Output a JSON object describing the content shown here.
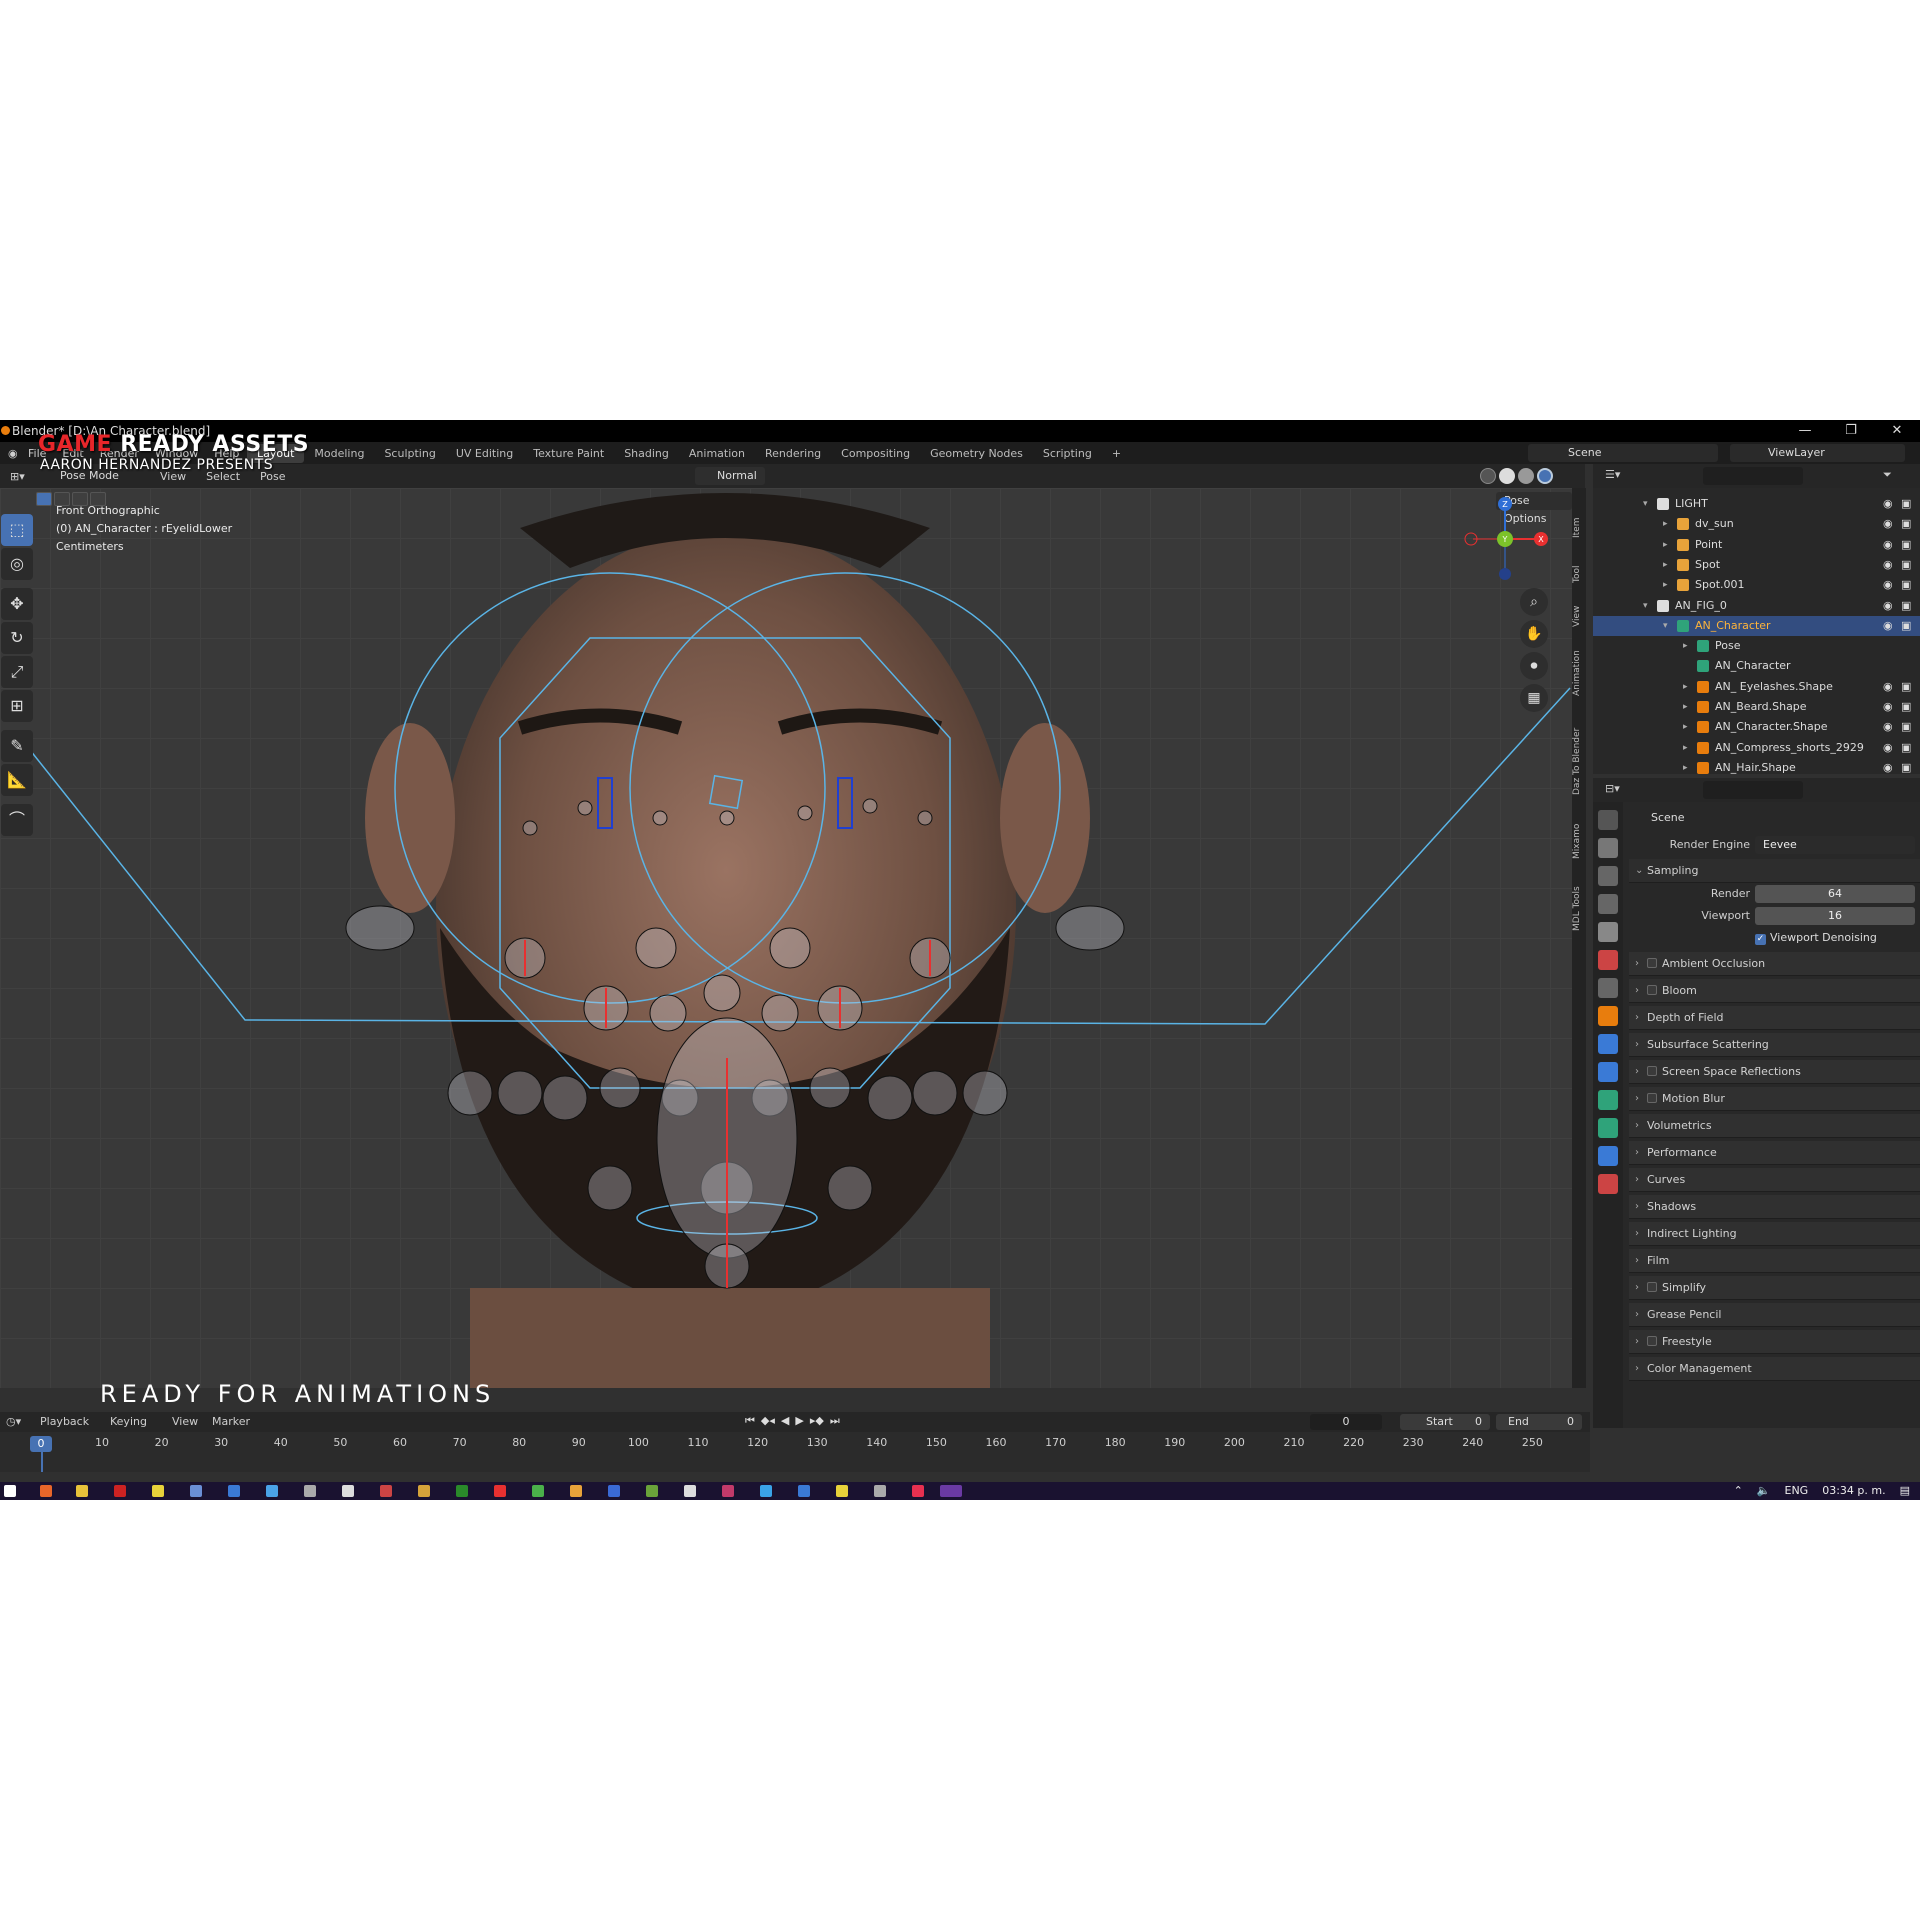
{
  "window": {
    "title": "Blender* [D:\\An Character.blend]",
    "controls": [
      "—",
      "❐",
      "✕"
    ]
  },
  "promo": {
    "title_red": "GAME",
    "title_white": "READY ASSETS",
    "subtitle": "AARON HERNANDEZ PRESENTS",
    "bottom": "READY FOR ANIMATIONS"
  },
  "menubar": {
    "items": [
      "File",
      "Edit",
      "Render",
      "Window",
      "Help"
    ],
    "workspaces": [
      "Layout",
      "Modeling",
      "Sculpting",
      "UV Editing",
      "Texture Paint",
      "Shading",
      "Animation",
      "Rendering",
      "Compositing",
      "Geometry Nodes",
      "Scripting",
      "+"
    ],
    "scene": "Scene",
    "view_layer": "ViewLayer"
  },
  "viewport_header": {
    "mode": "Pose Mode",
    "menus": [
      "View",
      "Select",
      "Pose"
    ],
    "orientation": "Normal",
    "pose_options": "Pose Options"
  },
  "viewport": {
    "view_name": "Front Orthographic",
    "active_object": "(0) AN_Character : rEyelidLower",
    "units": "Centimeters"
  },
  "toolbar": {
    "tools": [
      {
        "name": "select-box-tool",
        "glyph": "⬚",
        "active": true
      },
      {
        "name": "cursor-tool",
        "glyph": "◎",
        "active": false
      },
      {
        "name": "move-tool",
        "glyph": "✥",
        "active": false
      },
      {
        "name": "rotate-tool",
        "glyph": "↻",
        "active": false
      },
      {
        "name": "scale-tool",
        "glyph": "⤢",
        "active": false
      },
      {
        "name": "transform-tool",
        "glyph": "⊞",
        "active": false
      },
      {
        "name": "annotate-tool",
        "glyph": "✎",
        "active": false
      },
      {
        "name": "measure-tool",
        "glyph": "📐",
        "active": false
      },
      {
        "name": "bone-roll-tool",
        "glyph": "⌒",
        "active": false
      }
    ]
  },
  "gizmo": {
    "z": "Z",
    "y": "Y",
    "x": "X"
  },
  "npanel_tabs": [
    "Item",
    "Tool",
    "View",
    "Animation",
    "Daz To Blender",
    "Mixamo",
    "MDL Tools"
  ],
  "outliner": {
    "rows": [
      {
        "label": "LIGHT",
        "indent": 0,
        "type": "collection",
        "arrow": "▾",
        "selected": false
      },
      {
        "label": "dv_sun",
        "indent": 1,
        "type": "light",
        "arrow": "▸",
        "selected": false
      },
      {
        "label": "Point",
        "indent": 1,
        "type": "light",
        "arrow": "▸",
        "selected": false
      },
      {
        "label": "Spot",
        "indent": 1,
        "type": "light",
        "arrow": "▸",
        "selected": false
      },
      {
        "label": "Spot.001",
        "indent": 1,
        "type": "light",
        "arrow": "▸",
        "selected": false
      },
      {
        "label": "AN_FIG_0",
        "indent": 0,
        "type": "collection",
        "arrow": "▾",
        "selected": false
      },
      {
        "label": "AN_Character",
        "indent": 1,
        "type": "armature",
        "arrow": "▾",
        "selected": true
      },
      {
        "label": "Pose",
        "indent": 2,
        "type": "pose",
        "arrow": "▸",
        "selected": false
      },
      {
        "label": "AN_Character",
        "indent": 2,
        "type": "armature-data",
        "arrow": "",
        "selected": false
      },
      {
        "label": "AN_ Eyelashes.Shape",
        "indent": 2,
        "type": "mesh",
        "arrow": "▸",
        "selected": false
      },
      {
        "label": "AN_Beard.Shape",
        "indent": 2,
        "type": "mesh",
        "arrow": "▸",
        "selected": false
      },
      {
        "label": "AN_Character.Shape",
        "indent": 2,
        "type": "mesh",
        "arrow": "▸",
        "selected": false
      },
      {
        "label": "AN_Compress_shorts_2929",
        "indent": 2,
        "type": "mesh",
        "arrow": "▸",
        "selected": false
      },
      {
        "label": "AN_Hair.Shape",
        "indent": 2,
        "type": "mesh",
        "arrow": "▸",
        "selected": false
      }
    ]
  },
  "properties": {
    "scene": "Scene",
    "render_engine_label": "Render Engine",
    "render_engine_value": "Eevee",
    "sampling_label": "Sampling",
    "render_label": "Render",
    "render_value": "64",
    "viewport_label": "Viewport",
    "viewport_value": "16",
    "denoising_label": "Viewport Denoising",
    "panels": [
      {
        "label": "Ambient Occlusion",
        "checkbox": true
      },
      {
        "label": "Bloom",
        "checkbox": true
      },
      {
        "label": "Depth of Field",
        "checkbox": false
      },
      {
        "label": "Subsurface Scattering",
        "checkbox": false
      },
      {
        "label": "Screen Space Reflections",
        "checkbox": true
      },
      {
        "label": "Motion Blur",
        "checkbox": true
      },
      {
        "label": "Volumetrics",
        "checkbox": false
      },
      {
        "label": "Performance",
        "checkbox": false
      },
      {
        "label": "Curves",
        "checkbox": false
      },
      {
        "label": "Shadows",
        "checkbox": false
      },
      {
        "label": "Indirect Lighting",
        "checkbox": false
      },
      {
        "label": "Film",
        "checkbox": false
      },
      {
        "label": "Simplify",
        "checkbox": true
      },
      {
        "label": "Grease Pencil",
        "checkbox": false
      },
      {
        "label": "Freestyle",
        "checkbox": true
      },
      {
        "label": "Color Management",
        "checkbox": false
      }
    ]
  },
  "timeline": {
    "menus": [
      "Playback",
      "Keying",
      "View",
      "Marker"
    ],
    "current_frame": "0",
    "start_label": "Start",
    "start_value": "0",
    "end_label": "End",
    "end_value": "0",
    "playhead": "0",
    "ticks": [
      "10",
      "20",
      "30",
      "40",
      "50",
      "60",
      "70",
      "80",
      "90",
      "100",
      "110",
      "120",
      "130",
      "140",
      "150",
      "160",
      "170",
      "180",
      "190",
      "200",
      "210",
      "220",
      "230",
      "240",
      "250"
    ]
  },
  "taskbar": {
    "language": "ENG",
    "clock": "03:34 p. m."
  },
  "colors": {
    "accent": "#4772b3",
    "selected_text": "#ffb43a",
    "bone_blue": "#5ab4e6",
    "bone_red": "#e83030"
  }
}
